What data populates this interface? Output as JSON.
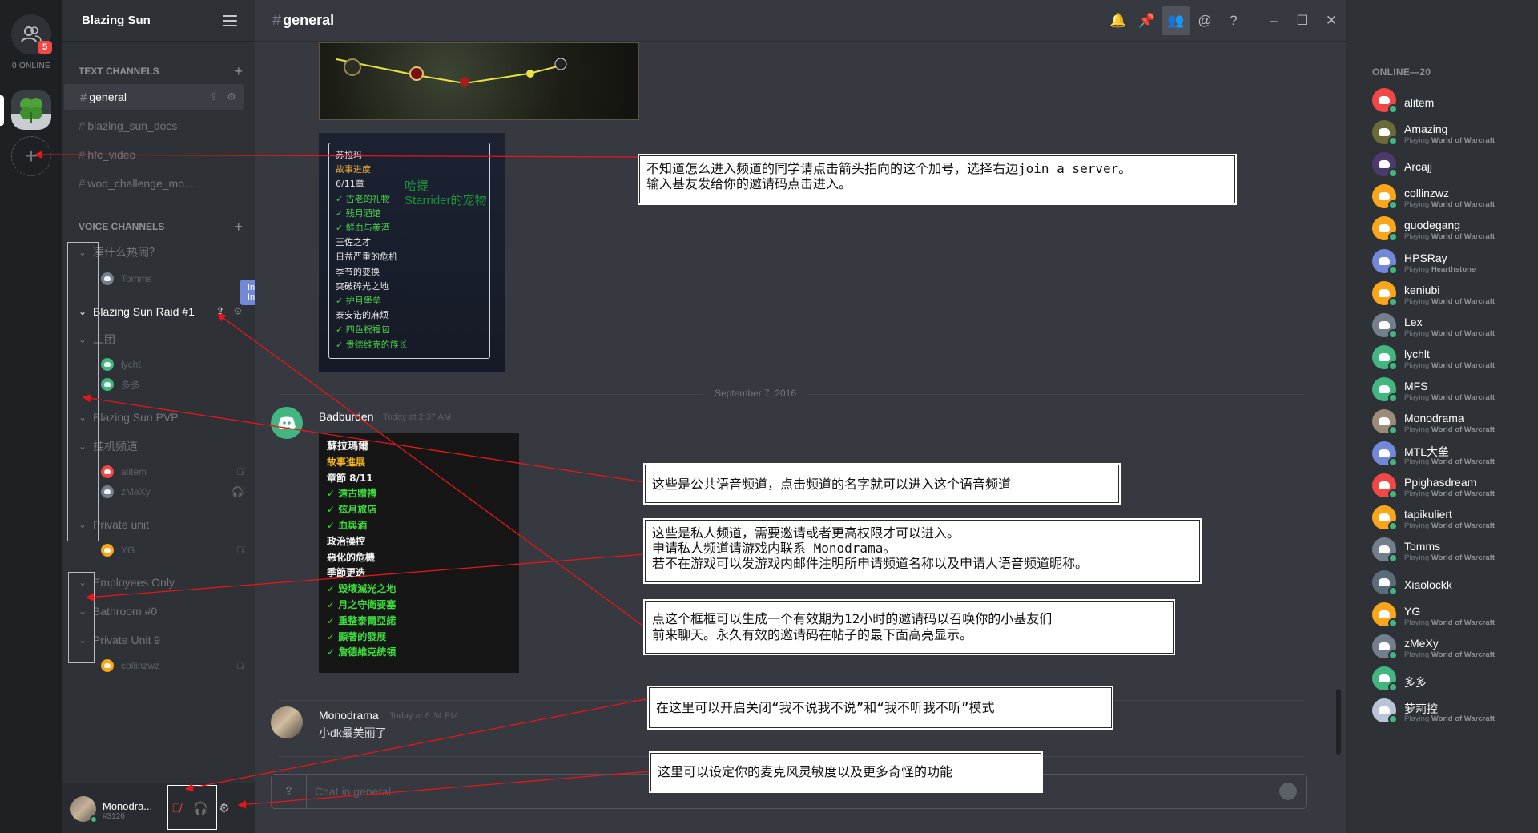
{
  "rail": {
    "badge": "5",
    "online_label": "0 ONLINE"
  },
  "guild": {
    "name": "Blazing Sun"
  },
  "text_channels": {
    "header": "TEXT CHANNELS",
    "items": [
      {
        "name": "general",
        "active": true
      },
      {
        "name": "blazing_sun_docs"
      },
      {
        "name": "hfc_video"
      },
      {
        "name": "wod_challenge_mo..."
      }
    ]
  },
  "voice_channels": {
    "header": "VOICE CHANNELS",
    "channels": [
      {
        "name": "凑什么热闹？",
        "users": [
          {
            "name": "Tomms",
            "color": "#747f8d"
          }
        ]
      },
      {
        "name": "Blazing Sun Raid #1",
        "lit": true,
        "users": []
      },
      {
        "name": "二团",
        "users": [
          {
            "name": "lycht",
            "color": "#43b581"
          },
          {
            "name": "多多",
            "color": "#43b581"
          }
        ]
      },
      {
        "name": "Blazing Sun PVP",
        "users": []
      },
      {
        "name": "挂机频道",
        "users": [
          {
            "name": "alitem",
            "color": "#f04747"
          },
          {
            "name": "zMeXy",
            "color": "#747f8d"
          }
        ]
      },
      {
        "name": "Private unit",
        "users": [
          {
            "name": "YG",
            "color": "#faa61a"
          }
        ]
      },
      {
        "name": "Employees Only",
        "users": []
      },
      {
        "name": "Bathroom #0",
        "users": []
      },
      {
        "name": "Private Unit 9",
        "users": [
          {
            "name": "collinzwz",
            "color": "#faa61a"
          }
        ]
      }
    ],
    "tooltip": "Instant Invite"
  },
  "user_panel": {
    "name": "Monodra...",
    "discriminator": "#3126"
  },
  "chat": {
    "channel": "general",
    "hash": "#",
    "image_text_1": {
      "title": "苏拉玛",
      "lines": [
        {
          "t": "故事进度",
          "c": "orange"
        },
        {
          "t": "6/11章",
          "c": "white"
        },
        {
          "t": "✓ 古老的礼物",
          "c": "green"
        },
        {
          "t": "✓ 残月酒馆",
          "c": "green"
        },
        {
          "t": "✓ 鲜血与美酒",
          "c": "green"
        },
        {
          "t": "王佐之才",
          "c": "white"
        },
        {
          "t": "日益严重的危机",
          "c": "white"
        },
        {
          "t": "季节的变换",
          "c": "white"
        },
        {
          "t": "突破碎光之地",
          "c": "white"
        },
        {
          "t": "✓ 护月堡垒",
          "c": "green"
        },
        {
          "t": "泰安诺的麻烦",
          "c": "white"
        },
        {
          "t": "✓ 四色祝福包",
          "c": "green"
        },
        {
          "t": "✓ 贵德维克的族长",
          "c": "green"
        }
      ],
      "overlay": "哈提\nStarrider的宠物"
    },
    "date_divider": "September 7, 2016",
    "messages": [
      {
        "user": "Badburden",
        "time": "Today at 2:37 AM"
      },
      {
        "user": "Monodrama",
        "time": "Today at 6:34 PM",
        "text": "小dk最美丽了"
      }
    ],
    "image_text_2": {
      "title": "蘇拉瑪爾",
      "lines": [
        {
          "t": "故事進展",
          "c": "orange"
        },
        {
          "t": "章節 8/11",
          "c": "white"
        },
        {
          "t": "✓ 遠古贈禮",
          "c": "green"
        },
        {
          "t": "✓ 弦月旅店",
          "c": "green"
        },
        {
          "t": "✓ 血與酒",
          "c": "green"
        },
        {
          "t": "政治操控",
          "c": "white"
        },
        {
          "t": "惡化的危機",
          "c": "white"
        },
        {
          "t": "季節更迭",
          "c": "white"
        },
        {
          "t": "✓ 毀壞滅光之地",
          "c": "green"
        },
        {
          "t": "✓ 月之守衛要塞",
          "c": "green"
        },
        {
          "t": "✓ 重整泰爾亞諾",
          "c": "green"
        },
        {
          "t": "✓ 顯著的發展",
          "c": "green"
        },
        {
          "t": "✓ 詹德維克統領",
          "c": "green"
        }
      ]
    },
    "input_placeholder": "Chat in general..."
  },
  "members": {
    "header": "ONLINE—20",
    "list": [
      {
        "name": "alitem",
        "color": "#f04747",
        "game": ""
      },
      {
        "name": "Amazing",
        "color": "#6b6b3a",
        "game": "World of Warcraft"
      },
      {
        "name": "Arcajj",
        "color": "#4b3a6b",
        "game": ""
      },
      {
        "name": "collinzwz",
        "color": "#faa61a",
        "game": "World of Warcraft"
      },
      {
        "name": "guodegang",
        "color": "#faa61a",
        "game": "World of Warcraft"
      },
      {
        "name": "HPSRay",
        "color": "#7289da",
        "game": "Hearthstone"
      },
      {
        "name": "keniubi",
        "color": "#faa61a",
        "game": "World of Warcraft"
      },
      {
        "name": "Lex",
        "color": "#747f8d",
        "game": "World of Warcraft"
      },
      {
        "name": "lychlt",
        "color": "#43b581",
        "game": "World of Warcraft"
      },
      {
        "name": "MFS",
        "color": "#43b581",
        "game": "World of Warcraft"
      },
      {
        "name": "Monodrama",
        "color": "#9c8b78",
        "game": "World of Warcraft"
      },
      {
        "name": "MTL大垒",
        "color": "#7289da",
        "game": "World of Warcraft"
      },
      {
        "name": "Ppighasdream",
        "color": "#f04747",
        "game": "World of Warcraft"
      },
      {
        "name": "tapikuliert",
        "color": "#faa61a",
        "game": "World of Warcraft"
      },
      {
        "name": "Tomms",
        "color": "#747f8d",
        "game": "World of Warcraft"
      },
      {
        "name": "Xiaolockk",
        "color": "#5a6b7a",
        "game": ""
      },
      {
        "name": "YG",
        "color": "#faa61a",
        "game": "World of Warcraft"
      },
      {
        "name": "zMeXy",
        "color": "#747f8d",
        "game": "World of Warcraft"
      },
      {
        "name": "多多",
        "color": "#43b581",
        "game": ""
      },
      {
        "name": "萝莉控",
        "color": "#b9c4d6",
        "game": "World of Warcraft"
      }
    ],
    "playing_prefix": "Playing"
  },
  "annotations": [
    "不知道怎么进入频道的同学请点击箭头指向的这个加号，选择右边join a server。\n输入基友发给你的邀请码点击进入。",
    "这些是公共语音频道，点击频道的名字就可以进入这个语音频道",
    "这些是私人频道，需要邀请或者更高权限才可以进入。\n申请私人频道请游戏内联系 Monodrama。\n若不在游戏可以发游戏内邮件注明所申请频道名称以及申请人语音频道昵称。",
    "点这个框框可以生成一个有效期为12小时的邀请码以召唤你的小基友们\n前来聊天。永久有效的邀请码在帖子的最下面高亮显示。",
    "在这里可以开启关闭“我不说我不说”和“我不听我不听”模式",
    "这里可以设定你的麦克风灵敏度以及更多奇怪的功能"
  ]
}
